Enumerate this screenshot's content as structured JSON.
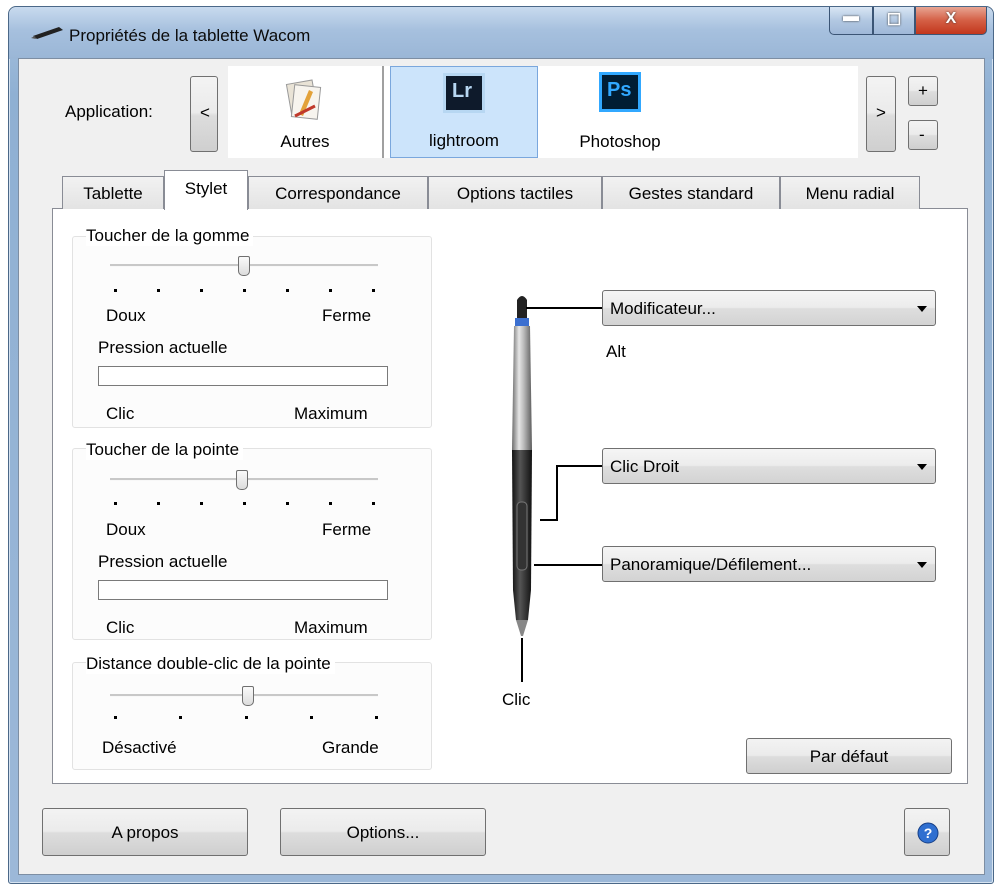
{
  "window": {
    "title": "Propriétés de la tablette Wacom",
    "close_glyph": "X"
  },
  "app_selector": {
    "label": "Application:",
    "prev": "<",
    "next": ">",
    "add": "+",
    "remove": "-",
    "apps": [
      {
        "name": "Autres",
        "icon": "pen-document-icon"
      },
      {
        "name": "lightroom",
        "icon_text": "Lr",
        "selected": true
      },
      {
        "name": "Photoshop",
        "icon_text": "Ps"
      }
    ]
  },
  "tabs": [
    "Tablette",
    "Stylet",
    "Correspondance",
    "Options tactiles",
    "Gestes standard",
    "Menu radial"
  ],
  "active_tab": "Stylet",
  "eraser_feel": {
    "title": "Toucher de la gomme",
    "min": "Doux",
    "max": "Ferme",
    "pressure_label": "Pression actuelle",
    "pressure_min": "Clic",
    "pressure_max": "Maximum"
  },
  "tip_feel": {
    "title": "Toucher de la pointe",
    "min": "Doux",
    "max": "Ferme",
    "pressure_label": "Pression actuelle",
    "pressure_min": "Clic",
    "pressure_max": "Maximum"
  },
  "double_click": {
    "title": "Distance double-clic de la pointe",
    "min": "Désactivé",
    "max": "Grande"
  },
  "pen": {
    "eraser_action": "Modificateur...",
    "eraser_sub": "Alt",
    "upper_button": "Clic Droit",
    "lower_button": "Panoramique/Défilement...",
    "tip_label": "Clic"
  },
  "buttons": {
    "default": "Par défaut",
    "about": "A propos",
    "options": "Options..."
  },
  "colors": {
    "lr_icon": "#b7d7f2",
    "ps_icon": "#31a8ff",
    "help": "#2f6fd0"
  }
}
